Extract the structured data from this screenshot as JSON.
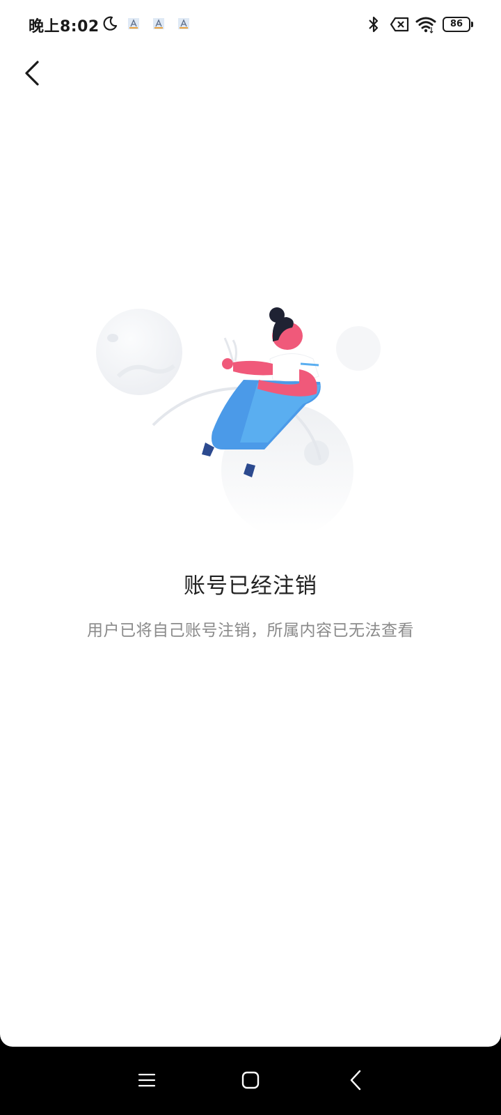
{
  "status_bar": {
    "time": "晚上8:02",
    "battery_level": "86",
    "icons": [
      "moon-icon",
      "notification-icon",
      "notification-icon",
      "notification-icon",
      "bluetooth-icon",
      "sim-disabled-icon",
      "wifi-icon",
      "battery-icon"
    ]
  },
  "header": {
    "back_icon": "chevron-left-icon"
  },
  "empty_state": {
    "illustration": "woman-sitting-on-moon-illustration",
    "title": "账号已经注销",
    "description": "用户已将自己账号注销，所属内容已无法查看"
  },
  "nav_bar": {
    "icons": [
      "menu-icon",
      "home-icon",
      "back-icon"
    ]
  },
  "colors": {
    "background": "#ffffff",
    "title": "#222222",
    "description": "#8a8a8a",
    "accent_pink": "#f0597a",
    "accent_blue": "#4b9ae8"
  }
}
